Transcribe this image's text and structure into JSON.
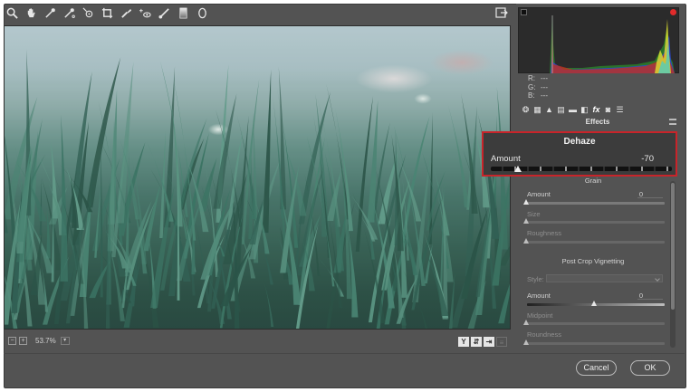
{
  "toolbar": {
    "tools": [
      "zoom-icon",
      "hand-icon",
      "eyedropper-icon",
      "color-sampler-icon",
      "targeted-adjustment-icon",
      "crop-icon",
      "spot-removal-icon",
      "red-eye-icon",
      "brush-icon",
      "graduated-filter-icon",
      "radial-filter-icon"
    ]
  },
  "histogram": {
    "r_label": "R:",
    "r_value": "---",
    "g_label": "G:",
    "g_value": "---",
    "b_label": "B:",
    "b_value": "---"
  },
  "panel": {
    "title": "Effects",
    "active_tab_label": "fx"
  },
  "dehaze": {
    "title": "Dehaze",
    "amount_label": "Amount",
    "amount_value": "-70",
    "amount_fraction": 0.15
  },
  "grain": {
    "title": "Grain",
    "amount_label": "Amount",
    "amount_value": "0",
    "size_label": "Size",
    "roughness_label": "Roughness"
  },
  "vignette": {
    "title": "Post Crop Vignetting",
    "style_label": "Style:",
    "amount_label": "Amount",
    "amount_value": "0",
    "midpoint_label": "Midpoint",
    "roundness_label": "Roundness"
  },
  "statusbar": {
    "zoom": "53.7%",
    "toggle_y": "Y"
  },
  "dialog": {
    "cancel_label": "Cancel",
    "ok_label": "OK"
  }
}
